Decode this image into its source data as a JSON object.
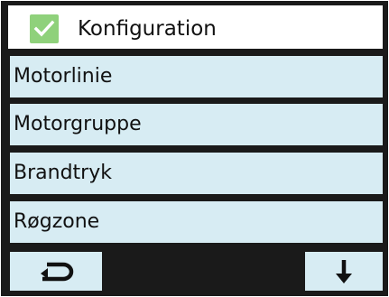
{
  "header": {
    "title": "Konfiguration",
    "icon": "checkmark-icon",
    "icon_color": "#8fd17b"
  },
  "menu": {
    "items": [
      {
        "label": "Motorlinie"
      },
      {
        "label": "Motorgruppe"
      },
      {
        "label": "Brandtryk"
      },
      {
        "label": "Røgzone"
      }
    ]
  },
  "footer": {
    "back_icon": "return-icon",
    "down_icon": "arrow-down-icon",
    "button_color": "#d7ecf3"
  }
}
